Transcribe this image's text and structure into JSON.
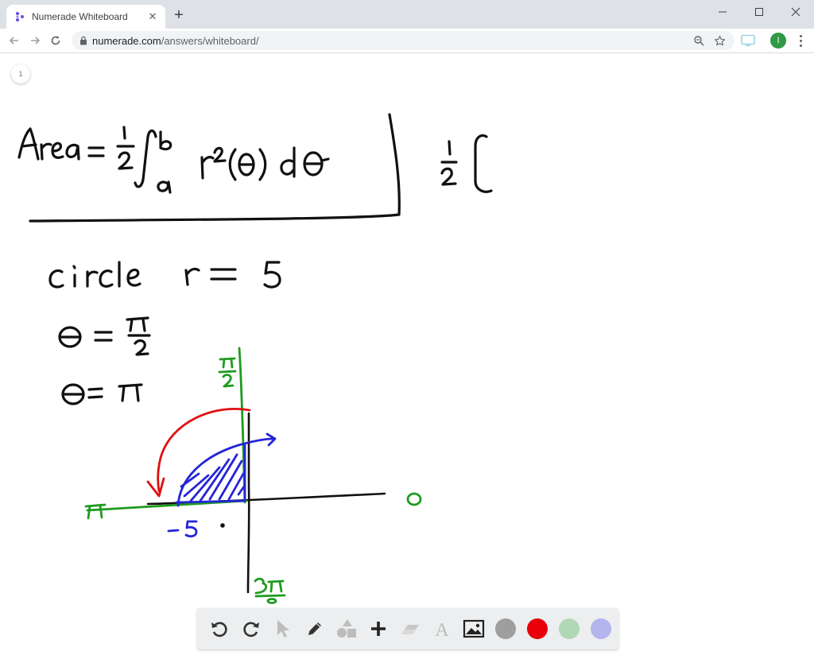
{
  "browser": {
    "tab_title": "Numerade Whiteboard",
    "tab_close": "✕",
    "new_tab": "+",
    "url_host": "numerade.com",
    "url_path": "/answers/whiteboard/",
    "profile_initial": "I",
    "profile_color": "#2e9a45"
  },
  "whiteboard": {
    "page_number": "1",
    "ink_colors": {
      "black": "#111111",
      "green": "#1e9b1e",
      "red": "#e01010",
      "blue": "#2424d8"
    }
  },
  "draw_toolbar": {
    "tools": [
      "undo-icon",
      "redo-icon",
      "pointer-icon",
      "pen-icon",
      "shapes-icon",
      "add-icon",
      "eraser-icon",
      "text-icon",
      "image-icon"
    ],
    "colors": [
      "#9e9e9e",
      "#e8000b",
      "#b1d8b6",
      "#b3b5ec"
    ]
  }
}
